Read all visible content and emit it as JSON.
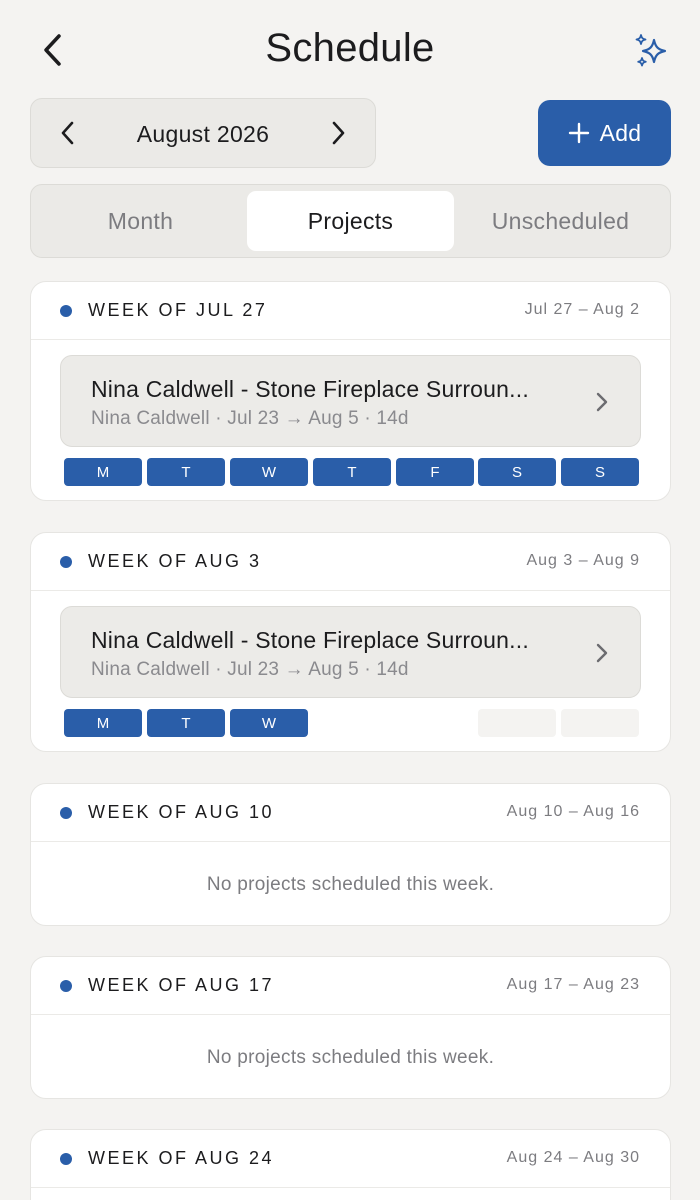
{
  "header": {
    "title": "Schedule",
    "back_icon": "chevron-left-icon",
    "assistant_icon": "sparkles-icon"
  },
  "month_picker": {
    "label": "August 2026",
    "prev_icon": "chevron-left-icon",
    "next_icon": "chevron-right-icon"
  },
  "add_button": {
    "label": "Add",
    "icon": "plus-icon"
  },
  "tabs": [
    {
      "label": "Month",
      "active": false
    },
    {
      "label": "Projects",
      "active": true
    },
    {
      "label": "Unscheduled",
      "active": false
    }
  ],
  "colors": {
    "accent": "#2a5ea9",
    "background": "#f4f3f1",
    "card": "#ffffff",
    "muted_text": "#7c7c80"
  },
  "weeks": [
    {
      "title": "WEEK OF JUL 27",
      "range": "Jul 27 – Aug 2",
      "project": {
        "title": "Nina Caldwell - Stone Fireplace Surroun...",
        "subtitle": "Nina Caldwell · Jul 23 → Aug 5 · 14d"
      },
      "days": [
        {
          "label": "M",
          "scheduled": true
        },
        {
          "label": "T",
          "scheduled": true
        },
        {
          "label": "W",
          "scheduled": true
        },
        {
          "label": "T",
          "scheduled": true
        },
        {
          "label": "F",
          "scheduled": true
        },
        {
          "label": "S",
          "scheduled": true
        },
        {
          "label": "S",
          "scheduled": true
        }
      ]
    },
    {
      "title": "WEEK OF AUG 3",
      "range": "Aug 3 – Aug 9",
      "project": {
        "title": "Nina Caldwell - Stone Fireplace Surroun...",
        "subtitle": "Nina Caldwell · Jul 23 → Aug 5 · 14d"
      },
      "days": [
        {
          "label": "M",
          "scheduled": true
        },
        {
          "label": "T",
          "scheduled": true
        },
        {
          "label": "W",
          "scheduled": true
        },
        {
          "label": "",
          "scheduled": false
        },
        {
          "label": "",
          "scheduled": false
        },
        {
          "label": "",
          "scheduled": false
        },
        {
          "label": "",
          "scheduled": false
        }
      ]
    },
    {
      "title": "WEEK OF AUG 10",
      "range": "Aug 10 – Aug 16",
      "empty_message": "No projects scheduled this week."
    },
    {
      "title": "WEEK OF AUG 17",
      "range": "Aug 17 – Aug 23",
      "empty_message": "No projects scheduled this week."
    },
    {
      "title": "WEEK OF AUG 24",
      "range": "Aug 24 – Aug 30"
    }
  ]
}
